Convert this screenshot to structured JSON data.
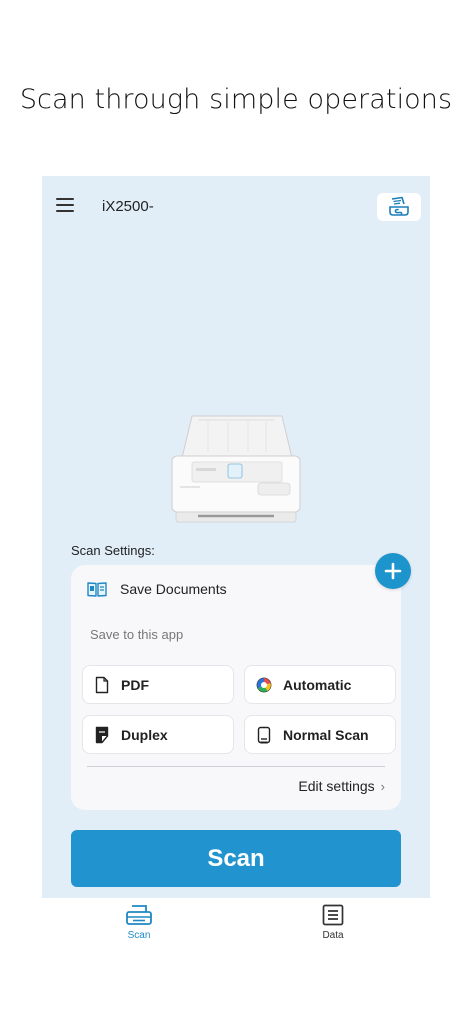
{
  "caption": "Scan through simple operations",
  "header": {
    "device_name": "iX2500-"
  },
  "scan_settings": {
    "label": "Scan Settings:",
    "profile_name": "Save Documents",
    "save_destination": "Save to this app",
    "options": {
      "file_format": "PDF",
      "color_mode": "Automatic",
      "sides": "Duplex",
      "scan_mode": "Normal Scan"
    },
    "edit_label": "Edit settings"
  },
  "scan_button": "Scan",
  "tabs": {
    "scan": "Scan",
    "data": "Data"
  },
  "colors": {
    "accent": "#2194cf",
    "background": "#e1eef8",
    "card": "#f8f8fa"
  }
}
